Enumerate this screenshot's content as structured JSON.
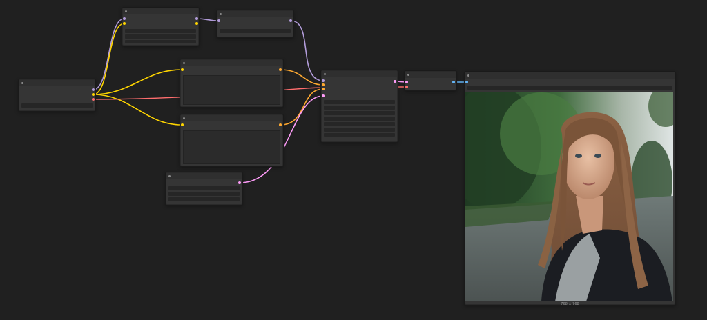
{
  "canvas": {
    "background": "#202020"
  },
  "nodes": {
    "checkpoint_loader": {
      "title": ""
    },
    "lora_loader": {
      "title": ""
    },
    "lora_strength": {
      "title": ""
    },
    "positive_prompt": {
      "title": "",
      "text": ""
    },
    "negative_prompt": {
      "title": "",
      "text": ""
    },
    "empty_latent": {
      "title": ""
    },
    "ksampler": {
      "title": ""
    },
    "vae_decode": {
      "title": ""
    },
    "preview_image": {
      "title": "",
      "caption": "768 × 768"
    }
  },
  "wire_colors": {
    "model": "#b39ddb",
    "clip": "#ffd500",
    "vae": "#ff6e6e",
    "conditioning": "#ffa931",
    "latent": "#ff9cf9",
    "image": "#64b5f6"
  }
}
